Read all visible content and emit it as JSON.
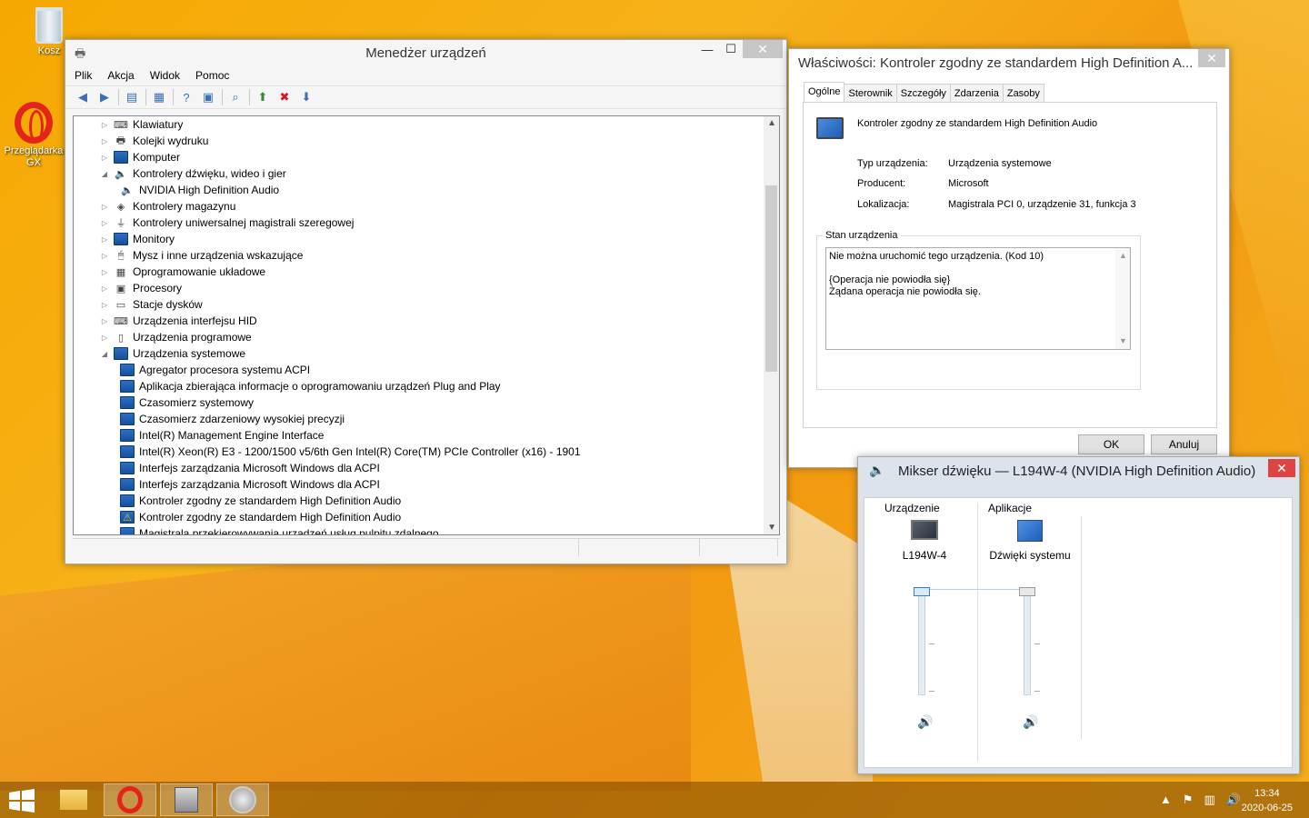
{
  "desktop": {
    "icons": [
      {
        "label": "Kosz"
      },
      {
        "label": "Przeglądarka GX"
      }
    ]
  },
  "devmgr": {
    "title": "Menedżer urządzeń",
    "menu": [
      "Plik",
      "Akcja",
      "Widok",
      "Pomoc"
    ],
    "tree": [
      {
        "label": "Klawiatury",
        "level": 0,
        "expanded": false,
        "icon": "keyboard-icon"
      },
      {
        "label": "Kolejki wydruku",
        "level": 0,
        "expanded": false,
        "icon": "printer-icon"
      },
      {
        "label": "Komputer",
        "level": 0,
        "expanded": false,
        "icon": "computer-icon"
      },
      {
        "label": "Kontrolery dźwięku, wideo i gier",
        "level": 0,
        "expanded": true,
        "icon": "speaker-icon"
      },
      {
        "label": "NVIDIA High Definition Audio",
        "level": 1,
        "icon": "speaker-icon"
      },
      {
        "label": "Kontrolery magazynu",
        "level": 0,
        "expanded": false,
        "icon": "storage-icon"
      },
      {
        "label": "Kontrolery uniwersalnej magistrali szeregowej",
        "level": 0,
        "expanded": false,
        "icon": "usb-icon"
      },
      {
        "label": "Monitory",
        "level": 0,
        "expanded": false,
        "icon": "monitor-icon"
      },
      {
        "label": "Mysz i inne urządzenia wskazujące",
        "level": 0,
        "expanded": false,
        "icon": "mouse-icon"
      },
      {
        "label": "Oprogramowanie układowe",
        "level": 0,
        "expanded": false,
        "icon": "chip-icon"
      },
      {
        "label": "Procesory",
        "level": 0,
        "expanded": false,
        "icon": "cpu-icon"
      },
      {
        "label": "Stacje dysków",
        "level": 0,
        "expanded": false,
        "icon": "disk-icon"
      },
      {
        "label": "Urządzenia interfejsu HID",
        "level": 0,
        "expanded": false,
        "icon": "hid-icon"
      },
      {
        "label": "Urządzenia programowe",
        "level": 0,
        "expanded": false,
        "icon": "software-device-icon"
      },
      {
        "label": "Urządzenia systemowe",
        "level": 0,
        "expanded": true,
        "icon": "system-device-icon"
      },
      {
        "label": "Agregator procesora systemu ACPI",
        "level": 1,
        "icon": "system-device-icon"
      },
      {
        "label": "Aplikacja zbierająca informacje o oprogramowaniu urządzeń Plug and Play",
        "level": 1,
        "icon": "system-device-icon"
      },
      {
        "label": "Czasomierz systemowy",
        "level": 1,
        "icon": "system-device-icon"
      },
      {
        "label": "Czasomierz zdarzeniowy wysokiej precyzji",
        "level": 1,
        "icon": "system-device-icon"
      },
      {
        "label": "Intel(R) Management Engine Interface",
        "level": 1,
        "icon": "system-device-icon"
      },
      {
        "label": "Intel(R) Xeon(R) E3 - 1200/1500 v5/6th Gen Intel(R) Core(TM) PCIe Controller (x16) - 1901",
        "level": 1,
        "icon": "system-device-icon"
      },
      {
        "label": "Interfejs zarządzania Microsoft Windows dla ACPI",
        "level": 1,
        "icon": "system-device-icon"
      },
      {
        "label": "Interfejs zarządzania Microsoft Windows dla ACPI",
        "level": 1,
        "icon": "system-device-icon"
      },
      {
        "label": "Kontroler zgodny ze standardem High Definition Audio",
        "level": 1,
        "icon": "system-device-icon"
      },
      {
        "label": "Kontroler zgodny ze standardem High Definition Audio",
        "level": 1,
        "icon": "warning-device-icon"
      },
      {
        "label": "Magistrala przekierowywania urządzeń usług pulpitu zdalnego",
        "level": 1,
        "icon": "system-device-icon"
      }
    ]
  },
  "props": {
    "title": "Właściwości: Kontroler zgodny ze standardem High Definition A...",
    "tabs": [
      "Ogólne",
      "Sterownik",
      "Szczegóły",
      "Zdarzenia",
      "Zasoby"
    ],
    "device_name": "Kontroler zgodny ze standardem High Definition Audio",
    "type_label": "Typ urządzenia:",
    "type_value": "Urządzenia systemowe",
    "vendor_label": "Producent:",
    "vendor_value": "Microsoft",
    "location_label": "Lokalizacja:",
    "location_value": "Magistrala PCI 0, urządzenie 31, funkcja 3",
    "status_group": "Stan urządzenia",
    "status_line1": "Nie można uruchomić tego urządzenia. (Kod 10)",
    "status_line2": "{Operacja nie powiodła się}",
    "status_line3": "Żądana operacja nie powiodła się.",
    "ok": "OK",
    "cancel": "Anuluj"
  },
  "mixer": {
    "title": "Mikser dźwięku — L194W-4 (NVIDIA High Definition Audio)",
    "device_header": "Urządzenie",
    "apps_header": "Aplikacje",
    "device_name": "L194W-4",
    "app_name": "Dźwięki systemu",
    "device_volume": 1.0,
    "app_volume": 1.0
  },
  "taskbar": {
    "time": "13:34",
    "date": "2020-06-25"
  }
}
